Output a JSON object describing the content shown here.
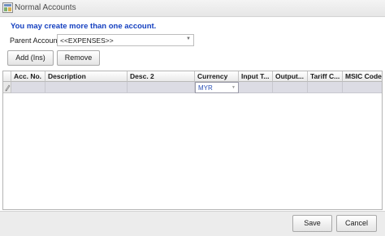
{
  "window": {
    "title": "Normal Accounts",
    "icon": "app-window-icon"
  },
  "notice": "You may create more than one account.",
  "parent_account": {
    "label": "Parent Account",
    "value": "<<EXPENSES>>"
  },
  "toolbar": {
    "add_label": "Add  (Ins)",
    "remove_label": "Remove"
  },
  "grid": {
    "columns": [
      "Acc. No.",
      "Description",
      "Desc. 2",
      "Currency",
      "Input T...",
      "Output...",
      "Tariff C...",
      "MSIC Code"
    ],
    "new_row": {
      "currency": "MYR"
    },
    "row_indicator_icon": "pencil-icon"
  },
  "footer": {
    "save_label": "Save",
    "cancel_label": "Cancel"
  },
  "colors": {
    "notice_text": "#1540c0",
    "row_fill": "#dcdce4",
    "selected_text": "#2a4fb5"
  }
}
